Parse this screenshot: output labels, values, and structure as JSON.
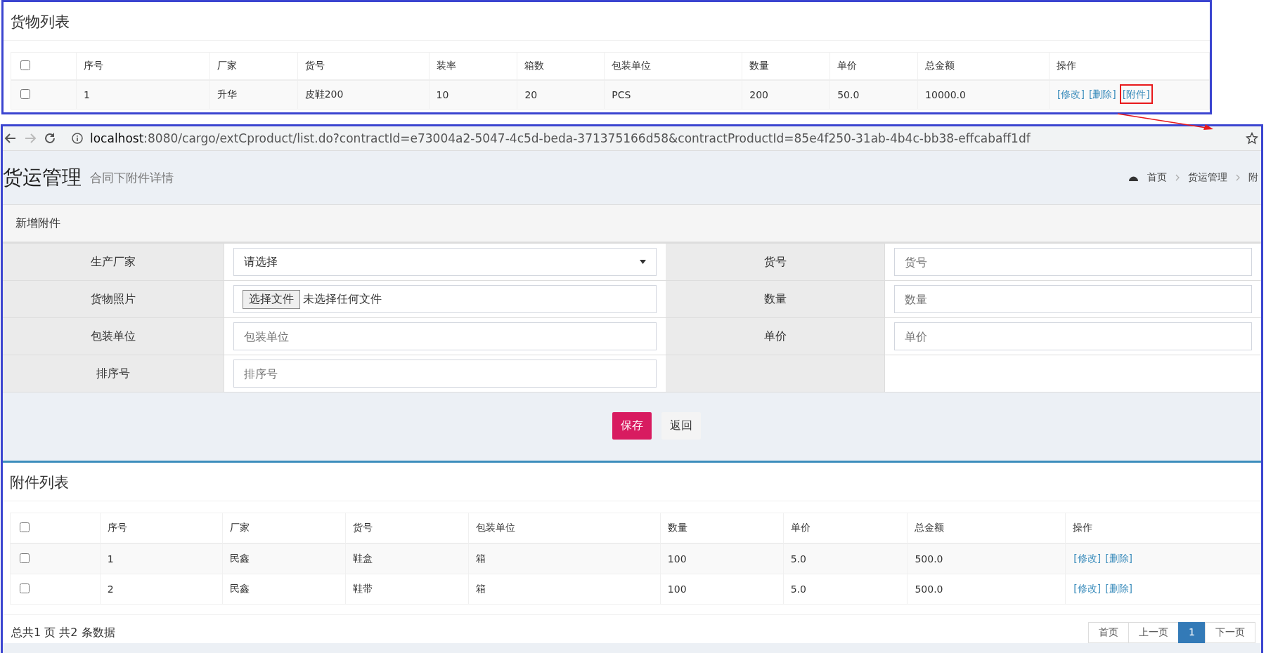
{
  "cargo_list": {
    "title": "货物列表",
    "header_checked": false,
    "columns": [
      "序号",
      "厂家",
      "货号",
      "装率",
      "箱数",
      "包装单位",
      "数量",
      "单价",
      "总金额",
      "操作"
    ],
    "rows": [
      {
        "checked": false,
        "cells": [
          "1",
          "升华",
          "皮鞋200",
          "10",
          "20",
          "PCS",
          "200",
          "50.0",
          "10000.0"
        ],
        "actions": [
          {
            "label": "[修改]",
            "highlighted": false
          },
          {
            "label": "[删除]",
            "highlighted": false
          },
          {
            "label": "[附件]",
            "highlighted": true
          }
        ]
      }
    ]
  },
  "browser": {
    "url_host": "localhost",
    "url_path": ":8080/cargo/extCproduct/list.do?contractId=e73004a2-5047-4c5d-beda-371375166d58&contractProductId=85e4f250-31ab-4b4c-bb38-effcabaff1df",
    "page_title": "货运管理",
    "page_subtitle": "合同下附件详情",
    "breadcrumb": [
      "首页",
      "货运管理",
      "附"
    ]
  },
  "form": {
    "title": "新增附件",
    "fields": [
      {
        "kind": "select",
        "label": "生产厂家",
        "value": "请选择"
      },
      {
        "kind": "text",
        "label": "货号",
        "placeholder": "货号"
      },
      {
        "kind": "file",
        "label": "货物照片",
        "button": "选择文件",
        "status": "未选择任何文件"
      },
      {
        "kind": "text",
        "label": "数量",
        "placeholder": "数量"
      },
      {
        "kind": "text",
        "label": "包装单位",
        "placeholder": "包装单位"
      },
      {
        "kind": "text",
        "label": "单价",
        "placeholder": "单价"
      },
      {
        "kind": "text",
        "label": "排序号",
        "placeholder": "排序号"
      },
      {
        "kind": "empty"
      }
    ],
    "buttons": [
      {
        "kind": "primary",
        "label": "保存"
      },
      {
        "kind": "plain",
        "label": "返回"
      }
    ]
  },
  "attachment_list": {
    "title": "附件列表",
    "header_checked": false,
    "columns": [
      "序号",
      "厂家",
      "货号",
      "包装单位",
      "数量",
      "单价",
      "总金额",
      "操作"
    ],
    "rows": [
      {
        "checked": false,
        "cells": [
          "1",
          "民鑫",
          "鞋盒",
          "箱",
          "100",
          "5.0",
          "500.0"
        ],
        "actions": [
          {
            "label": "[修改]",
            "highlighted": false
          },
          {
            "label": "[删除]",
            "highlighted": false
          }
        ]
      },
      {
        "checked": false,
        "cells": [
          "2",
          "民鑫",
          "鞋带",
          "箱",
          "100",
          "5.0",
          "500.0"
        ],
        "actions": [
          {
            "label": "[修改]",
            "highlighted": false
          },
          {
            "label": "[删除]",
            "highlighted": false
          }
        ]
      }
    ],
    "summary": "总共1 页   共2 条数据",
    "pagination": [
      {
        "label": "首页",
        "selected": false
      },
      {
        "label": "上一页",
        "selected": false
      },
      {
        "label": "1",
        "selected": true
      },
      {
        "label": "下一页",
        "selected": false
      }
    ]
  }
}
